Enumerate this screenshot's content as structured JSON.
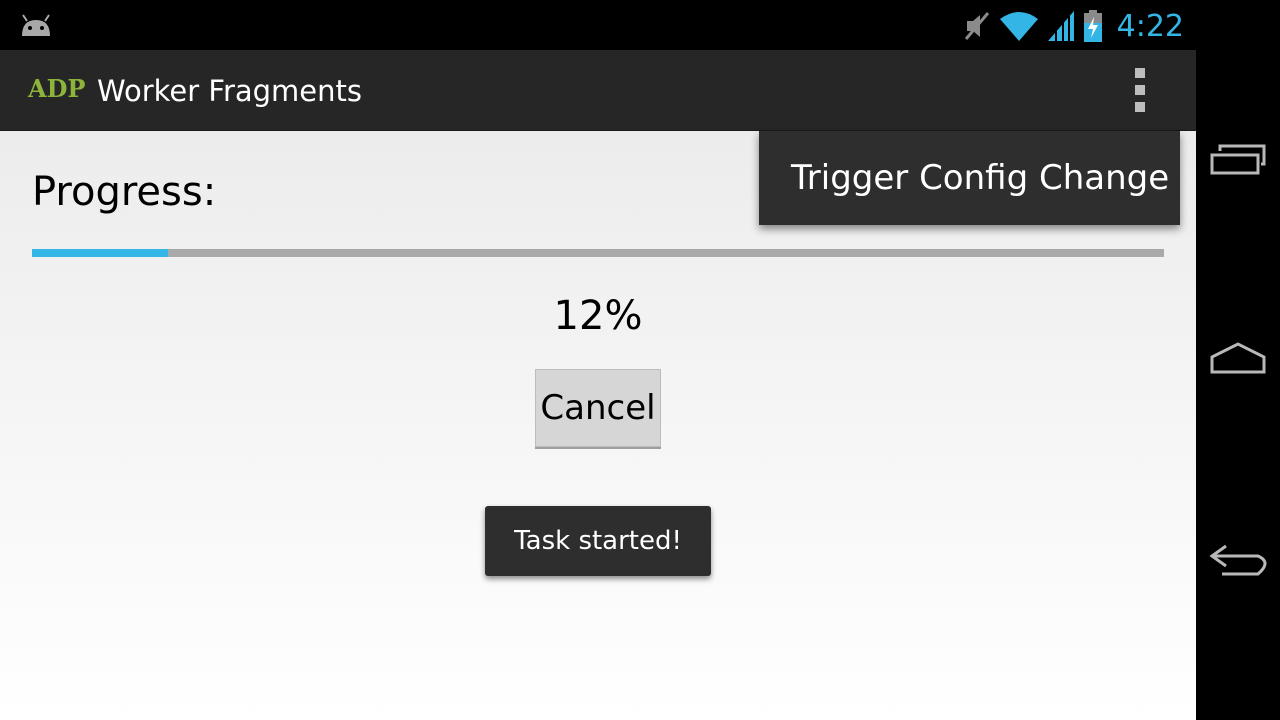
{
  "status_bar": {
    "time": "4:22",
    "icons": [
      "android-debug-icon",
      "mute-icon",
      "wifi-icon",
      "signal-icon",
      "battery-charging-icon"
    ],
    "accent_color": "#33b5e5"
  },
  "action_bar": {
    "logo": "ADP",
    "title": "Worker Fragments",
    "overflow_icon": "overflow-menu-icon"
  },
  "menu": {
    "items": [
      {
        "label": "Trigger Config Change"
      }
    ]
  },
  "main": {
    "progress_label": "Progress:",
    "progress_fraction": 0.12,
    "percent_text": "12%",
    "cancel_label": "Cancel"
  },
  "toast": {
    "message": "Task started!"
  },
  "nav_bar": {
    "icons": [
      "recent-apps-icon",
      "home-icon",
      "back-icon"
    ]
  }
}
